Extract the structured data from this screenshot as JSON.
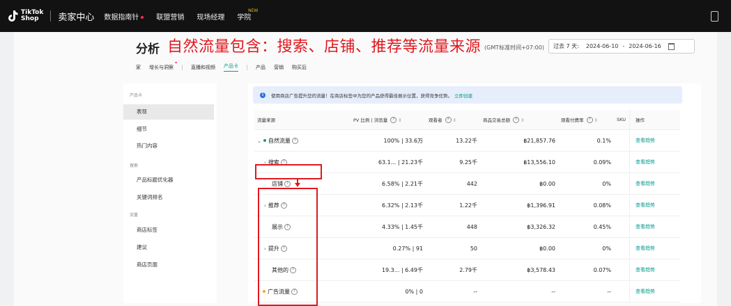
{
  "topbar": {
    "logo_text_1": "TikTok",
    "logo_text_2": "Shop",
    "brand": "卖家中心",
    "nav": [
      {
        "label": "数据指南针",
        "dot": true
      },
      {
        "label": "联盟营销"
      },
      {
        "label": "现场经理"
      },
      {
        "label": "学院",
        "badge": "NEW"
      }
    ]
  },
  "header": {
    "title": "分析",
    "annotation": "自然流量包含：搜索、店铺、推荐等流量来源",
    "timezone": "(GMT标准时间+07:00)",
    "date_label": "过去 7 天:",
    "date_start": "2024-06-10",
    "date_sep": "-",
    "date_end": "2024-06-16"
  },
  "tabs": [
    {
      "label": "家"
    },
    {
      "label": "增长与洞察",
      "dot": true
    },
    {
      "label": "直播和视频"
    },
    {
      "label": "产品卡",
      "active": true
    },
    {
      "label": "产品"
    },
    {
      "label": "营销"
    },
    {
      "label": "购买后"
    }
  ],
  "sidebar": {
    "group1": "产品卡",
    "group2": "搜索",
    "group3": "流量",
    "items": [
      "表现",
      "细节",
      "热门内容",
      "产品标题优化器",
      "关键词排名",
      "商店标签",
      "建议",
      "商店页面"
    ]
  },
  "notice": {
    "text": "使用商店广告提升您的流量！在商店标签中为您的产品获得最佳展示位置，获得竞争优势。",
    "link": "立即创建"
  },
  "table": {
    "headers": [
      "流量来源",
      "PV 比例 | 浏览量",
      "观看者",
      "商品交易总额",
      "观看付费率",
      "SKU",
      "操作"
    ],
    "rows": [
      {
        "source": "自然流量",
        "pv": "100% | 33.6万",
        "viewers": "13.22千",
        "gmv": "฿21,857.76",
        "rate": "0.1%",
        "action": "查看趋势"
      },
      {
        "source": "搜索",
        "pv": "63.1...  | 21.23千",
        "viewers": "9.25千",
        "gmv": "฿13,556.10",
        "rate": "0.09%",
        "action": "查看趋势"
      },
      {
        "source": "店铺",
        "pv": "6.58% | 2.21千",
        "viewers": "442",
        "gmv": "฿0.00",
        "rate": "0%",
        "action": "查看趋势"
      },
      {
        "source": "推荐",
        "pv": "6.32% | 2.13千",
        "viewers": "1.22千",
        "gmv": "฿1,396.91",
        "rate": "0.08%",
        "action": "查看趋势"
      },
      {
        "source": "展示",
        "pv": "4.33% | 1.45千",
        "viewers": "448",
        "gmv": "฿3,326.32",
        "rate": "0.45%",
        "action": "查看趋势"
      },
      {
        "source": "提升",
        "pv": "0.27% | 91",
        "viewers": "50",
        "gmv": "฿0.00",
        "rate": "0%",
        "action": "查看趋势"
      },
      {
        "source": "其他的",
        "pv": "19.3...  | 6.49千",
        "viewers": "2.79千",
        "gmv": "฿3,578.43",
        "rate": "0.07%",
        "action": "查看趋势"
      },
      {
        "source": "广告流量",
        "pv": "0% | 0",
        "viewers": "--",
        "gmv": "--",
        "rate": "--",
        "action": "查看趋势"
      }
    ]
  },
  "colors": {
    "accent": "#0a9b8f",
    "annotation_red": "#e0181e",
    "organic_dot": "#0a9b8f",
    "ad_dot": "#f5a623"
  }
}
